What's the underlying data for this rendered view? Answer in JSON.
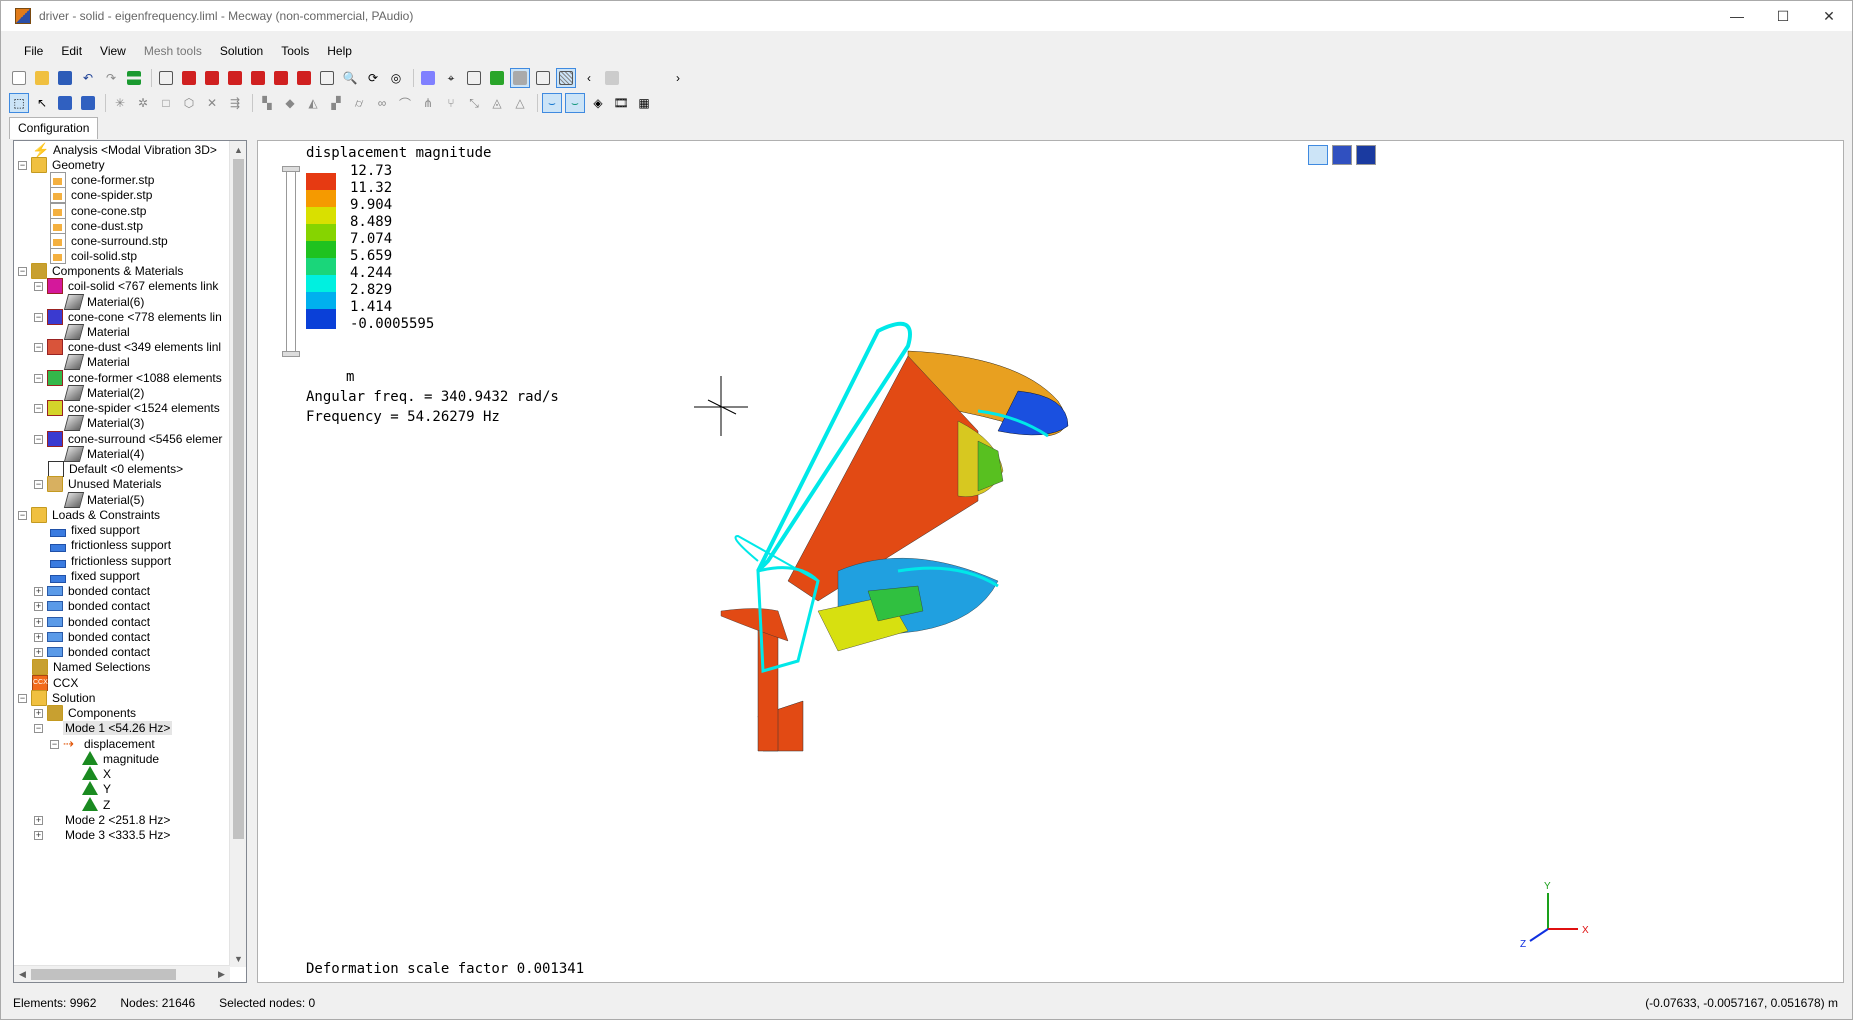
{
  "window": {
    "title": "driver - solid - eigenfrequency.liml - Mecway (non-commercial, PAudio)",
    "minimize": "—",
    "maximize": "☐",
    "close": "✕"
  },
  "menu": [
    {
      "label": "File"
    },
    {
      "label": "Edit"
    },
    {
      "label": "View"
    },
    {
      "label": "Mesh tools"
    },
    {
      "label": "Solution"
    },
    {
      "label": "Tools"
    },
    {
      "label": "Help"
    }
  ],
  "tabs": {
    "configuration": "Configuration"
  },
  "tree": {
    "analysis": "Analysis <Modal Vibration 3D>",
    "geometry": "Geometry",
    "geometry_files": [
      "cone-former.stp",
      "cone-spider.stp",
      "cone-cone.stp",
      "cone-dust.stp",
      "cone-surround.stp",
      "coil-solid.stp"
    ],
    "components_materials": "Components & Materials",
    "components": [
      {
        "label": "coil-solid <767 elements link",
        "material": "Material(6)",
        "color": "#d4189b"
      },
      {
        "label": "cone-cone <778 elements lin",
        "material": "Material",
        "color": "#3a3ad0"
      },
      {
        "label": "cone-dust <349 elements linl",
        "material": "Material",
        "color": "#d9543a"
      },
      {
        "label": "cone-former <1088 elements",
        "material": "Material(2)",
        "color": "#34b84a"
      },
      {
        "label": "cone-spider <1524 elements",
        "material": "Material(3)",
        "color": "#d4d42a"
      },
      {
        "label": "cone-surround <5456 elemer",
        "material": "Material(4)",
        "color": "#3a3ad0"
      }
    ],
    "default": "Default <0 elements>",
    "unused_materials": "Unused Materials",
    "unused_material_item": "Material(5)",
    "loads": "Loads & Constraints",
    "loads_items": [
      "fixed support",
      "frictionless support",
      "frictionless support",
      "fixed support",
      "bonded contact",
      "bonded contact",
      "bonded contact",
      "bonded contact",
      "bonded contact"
    ],
    "named_selections": "Named Selections",
    "ccx": "CCX",
    "solution": "Solution",
    "solution_components": "Components",
    "mode1": "Mode 1 <54.26 Hz>",
    "displacement": "displacement",
    "magnitude": "magnitude",
    "x": "X",
    "y": "Y",
    "z": "Z",
    "mode2": "Mode 2 <251.8 Hz>",
    "mode3": "Mode 3 <333.5 Hz>"
  },
  "viewport": {
    "legend_title": "displacement magnitude",
    "legend_values": [
      "12.73",
      "11.32",
      "9.904",
      "8.489",
      "7.074",
      "5.659",
      "4.244",
      "2.829",
      "1.414",
      "-0.0005595"
    ],
    "legend_colors": [
      "#e63a12",
      "#f59a00",
      "#d9e000",
      "#86d400",
      "#1fc21f",
      "#1ad67a",
      "#00f0e0",
      "#00b0ee",
      "#0a40d8"
    ],
    "units": "m",
    "angular_freq": "Angular freq. = 340.9432 rad/s",
    "frequency": "Frequency = 54.26279 Hz",
    "deformation": "Deformation scale factor 0.001341",
    "axes": {
      "x": "X",
      "y": "Y",
      "z": "Z"
    }
  },
  "status": {
    "elements": "Elements: 9962",
    "nodes": "Nodes: 21646",
    "selected_nodes": "Selected nodes: 0",
    "coords": "(-0.07633, -0.0057167, 0.051678) m"
  }
}
